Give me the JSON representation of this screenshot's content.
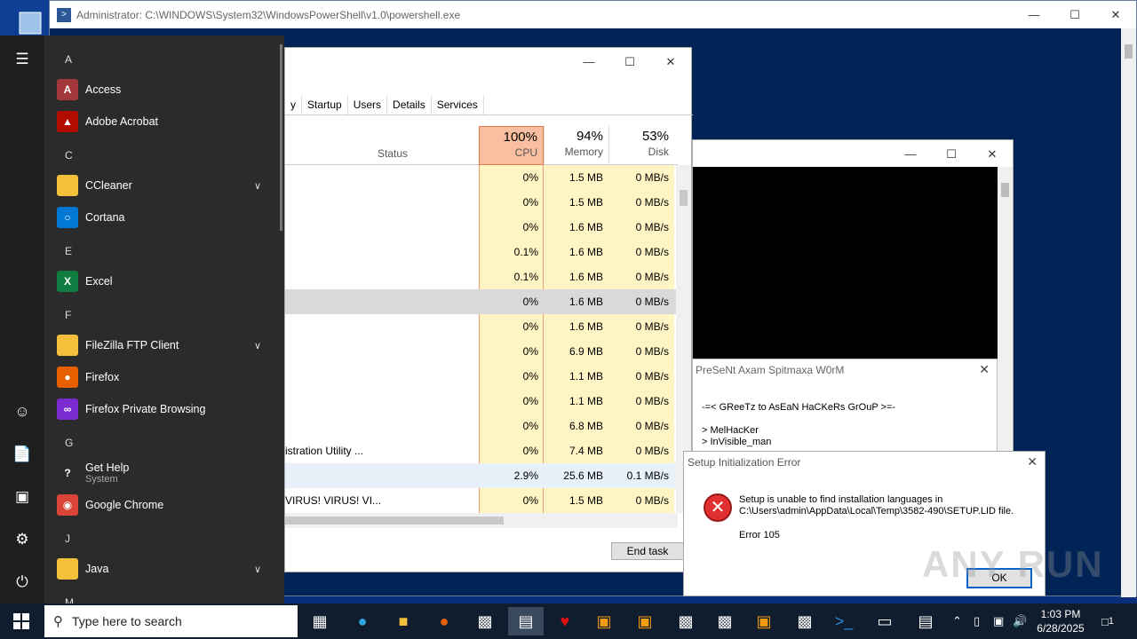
{
  "powershell": {
    "title": "Administrator: C:\\WINDOWS\\System32\\WindowsPowerShell\\v1.0\\powershell.exe"
  },
  "task_manager": {
    "tabs": [
      "y",
      "Startup",
      "Users",
      "Details",
      "Services"
    ],
    "header": {
      "status": "Status",
      "cpu_pct": "100%",
      "cpu_label": "CPU",
      "mem_pct": "94%",
      "mem_label": "Memory",
      "disk_pct": "53%",
      "disk_label": "Disk"
    },
    "rows": [
      {
        "name": "",
        "cpu": "0%",
        "mem": "1.5 MB",
        "disk": "0 MB/s"
      },
      {
        "name": "",
        "cpu": "0%",
        "mem": "1.5 MB",
        "disk": "0 MB/s"
      },
      {
        "name": "",
        "cpu": "0%",
        "mem": "1.6 MB",
        "disk": "0 MB/s"
      },
      {
        "name": "",
        "cpu": "0.1%",
        "mem": "1.6 MB",
        "disk": "0 MB/s"
      },
      {
        "name": "",
        "cpu": "0.1%",
        "mem": "1.6 MB",
        "disk": "0 MB/s"
      },
      {
        "name": "",
        "cpu": "0%",
        "mem": "1.6 MB",
        "disk": "0 MB/s"
      },
      {
        "name": "",
        "cpu": "0%",
        "mem": "1.6 MB",
        "disk": "0 MB/s"
      },
      {
        "name": "",
        "cpu": "0%",
        "mem": "6.9 MB",
        "disk": "0 MB/s"
      },
      {
        "name": "",
        "cpu": "0%",
        "mem": "1.1 MB",
        "disk": "0 MB/s"
      },
      {
        "name": "",
        "cpu": "0%",
        "mem": "1.1 MB",
        "disk": "0 MB/s"
      },
      {
        "name": "",
        "cpu": "0%",
        "mem": "6.8 MB",
        "disk": "0 MB/s"
      },
      {
        "name": "istration Utility ...",
        "cpu": "0%",
        "mem": "7.4 MB",
        "disk": "0 MB/s"
      },
      {
        "name": "",
        "cpu": "2.9%",
        "mem": "25.6 MB",
        "disk": "0.1 MB/s"
      },
      {
        "name": "VIRUS! VIRUS! VI...",
        "cpu": "0%",
        "mem": "1.5 MB",
        "disk": "0 MB/s"
      }
    ],
    "end_task_label": "End task"
  },
  "greetz_dialog": {
    "title": "PreSeNt Axam Spitmaxa W0rM",
    "line1": "-=< GReeTz to AsEaN HaCKeRs GrOuP >=-",
    "line2": "> MelHacKer",
    "line3": "> InVisible_man"
  },
  "setup_error": {
    "title": "Setup Initialization Error",
    "message_line1": "Setup is unable to find installation languages in",
    "message_line2": "C:\\Users\\admin\\AppData\\Local\\Temp\\3582-490\\SETUP.LID file.",
    "code": "Error 105",
    "ok_label": "OK"
  },
  "watermark": "ANY RUN",
  "start_menu": {
    "letters": [
      "A",
      "C",
      "E",
      "F",
      "G",
      "J",
      "M"
    ],
    "apps": [
      {
        "label": "Access",
        "icon": "access-icon",
        "color": "#a4373a",
        "glyph": "A"
      },
      {
        "label": "Adobe Acrobat",
        "icon": "acrobat-icon",
        "color": "#b30b00",
        "glyph": "▲"
      },
      {
        "label": "CCleaner",
        "icon": "folder-icon",
        "color": "#f3c03c",
        "glyph": ""
      },
      {
        "label": "Cortana",
        "icon": "cortana-icon",
        "color": "#0078d4",
        "glyph": "○"
      },
      {
        "label": "Excel",
        "icon": "excel-icon",
        "color": "#107c41",
        "glyph": "X"
      },
      {
        "label": "FileZilla FTP Client",
        "icon": "folder-icon",
        "color": "#f3c03c",
        "glyph": ""
      },
      {
        "label": "Firefox",
        "icon": "firefox-icon",
        "color": "#e66000",
        "glyph": "●"
      },
      {
        "label": "Firefox Private Browsing",
        "icon": "firefox-private-icon",
        "color": "#7b2bd1",
        "glyph": "∞"
      },
      {
        "label": "Get Help",
        "sub": "System",
        "icon": "get-help-icon",
        "color": "#2b2b2b",
        "glyph": "?"
      },
      {
        "label": "Google Chrome",
        "icon": "chrome-icon",
        "color": "#db4437",
        "glyph": "◉"
      },
      {
        "label": "Java",
        "icon": "folder-icon",
        "color": "#f3c03c",
        "glyph": ""
      }
    ]
  },
  "taskbar": {
    "search_placeholder": "Type here to search",
    "time": "1:03 PM",
    "date": "6/28/2025",
    "notification_count": "1"
  }
}
